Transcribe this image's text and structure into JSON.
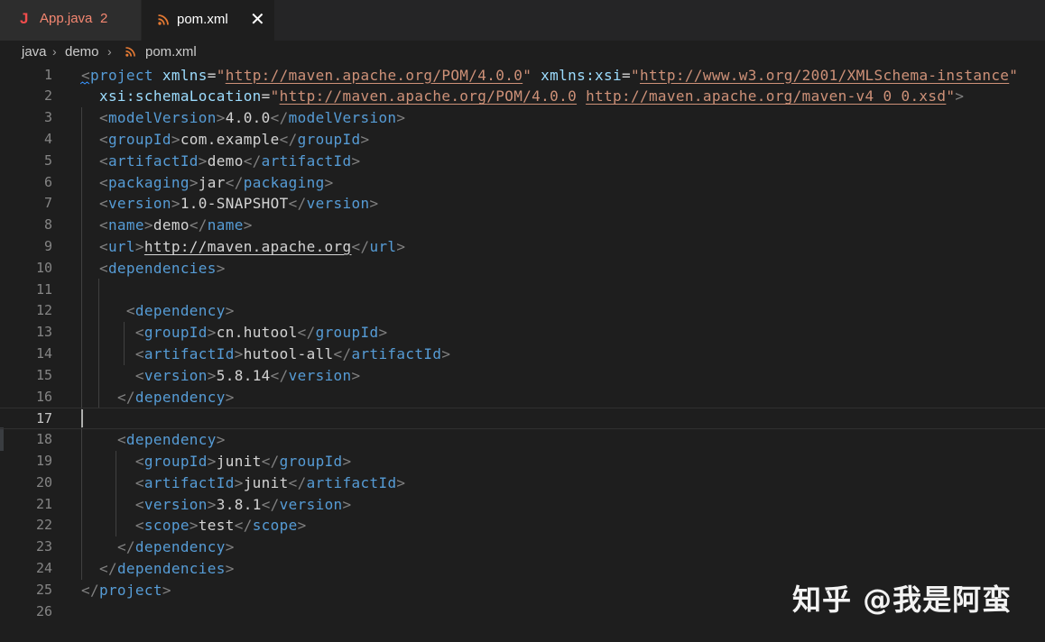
{
  "tabs": [
    {
      "icon": "java-file-icon",
      "label": "App.java",
      "badge": "2",
      "active": false
    },
    {
      "icon": "xml-rss-file-icon",
      "label": "pom.xml",
      "active": true,
      "close": "✕"
    }
  ],
  "breadcrumb": {
    "items": [
      "java",
      "demo",
      "pom.xml"
    ],
    "separator": "›"
  },
  "editor": {
    "current_line": 17,
    "line_numbers": [
      "1",
      "2",
      "3",
      "4",
      "5",
      "6",
      "7",
      "8",
      "9",
      "10",
      "11",
      "12",
      "13",
      "14",
      "15",
      "16",
      "17",
      "18",
      "19",
      "20",
      "21",
      "22",
      "23",
      "24",
      "25",
      "26"
    ],
    "lines": [
      [
        [
          "tag",
          "<"
        ],
        [
          "name",
          "project"
        ],
        [
          "text",
          " "
        ],
        [
          "attr",
          "xmlns"
        ],
        [
          "eq",
          "="
        ],
        [
          "str",
          "\""
        ],
        [
          "url",
          "http://maven.apache.org/POM/4.0.0"
        ],
        [
          "str",
          "\""
        ],
        [
          "text",
          " "
        ],
        [
          "attr",
          "xmlns:xsi"
        ],
        [
          "eq",
          "="
        ],
        [
          "str",
          "\""
        ],
        [
          "url",
          "http://www.w3.org/2001/XMLSchema-instance"
        ],
        [
          "str",
          "\""
        ]
      ],
      [
        [
          "text",
          "  "
        ],
        [
          "attr",
          "xsi:schemaLocation"
        ],
        [
          "eq",
          "="
        ],
        [
          "str",
          "\""
        ],
        [
          "url",
          "http://maven.apache.org/POM/4.0.0"
        ],
        [
          "str",
          " "
        ],
        [
          "url",
          "http://maven.apache.org/maven-v4_0_0.xsd"
        ],
        [
          "str",
          "\""
        ],
        [
          "tag",
          ">"
        ]
      ],
      [
        [
          "text",
          "  "
        ],
        [
          "tag",
          "<"
        ],
        [
          "name",
          "modelVersion"
        ],
        [
          "tag",
          ">"
        ],
        [
          "text",
          "4.0.0"
        ],
        [
          "tag",
          "</"
        ],
        [
          "name",
          "modelVersion"
        ],
        [
          "tag",
          ">"
        ]
      ],
      [
        [
          "text",
          "  "
        ],
        [
          "tag",
          "<"
        ],
        [
          "name",
          "groupId"
        ],
        [
          "tag",
          ">"
        ],
        [
          "text",
          "com.example"
        ],
        [
          "tag",
          "</"
        ],
        [
          "name",
          "groupId"
        ],
        [
          "tag",
          ">"
        ]
      ],
      [
        [
          "text",
          "  "
        ],
        [
          "tag",
          "<"
        ],
        [
          "name",
          "artifactId"
        ],
        [
          "tag",
          ">"
        ],
        [
          "text",
          "demo"
        ],
        [
          "tag",
          "</"
        ],
        [
          "name",
          "artifactId"
        ],
        [
          "tag",
          ">"
        ]
      ],
      [
        [
          "text",
          "  "
        ],
        [
          "tag",
          "<"
        ],
        [
          "name",
          "packaging"
        ],
        [
          "tag",
          ">"
        ],
        [
          "text",
          "jar"
        ],
        [
          "tag",
          "</"
        ],
        [
          "name",
          "packaging"
        ],
        [
          "tag",
          ">"
        ]
      ],
      [
        [
          "text",
          "  "
        ],
        [
          "tag",
          "<"
        ],
        [
          "name",
          "version"
        ],
        [
          "tag",
          ">"
        ],
        [
          "text",
          "1.0-SNAPSHOT"
        ],
        [
          "tag",
          "</"
        ],
        [
          "name",
          "version"
        ],
        [
          "tag",
          ">"
        ]
      ],
      [
        [
          "text",
          "  "
        ],
        [
          "tag",
          "<"
        ],
        [
          "name",
          "name"
        ],
        [
          "tag",
          ">"
        ],
        [
          "text",
          "demo"
        ],
        [
          "tag",
          "</"
        ],
        [
          "name",
          "name"
        ],
        [
          "tag",
          ">"
        ]
      ],
      [
        [
          "text",
          "  "
        ],
        [
          "tag",
          "<"
        ],
        [
          "name",
          "url"
        ],
        [
          "tag",
          ">"
        ],
        [
          "texturl",
          "http://maven.apache.org"
        ],
        [
          "tag",
          "</"
        ],
        [
          "name",
          "url"
        ],
        [
          "tag",
          ">"
        ]
      ],
      [
        [
          "text",
          "  "
        ],
        [
          "tag",
          "<"
        ],
        [
          "name",
          "dependencies"
        ],
        [
          "tag",
          ">"
        ]
      ],
      [],
      [
        [
          "text",
          "     "
        ],
        [
          "tag",
          "<"
        ],
        [
          "name",
          "dependency"
        ],
        [
          "tag",
          ">"
        ]
      ],
      [
        [
          "text",
          "      "
        ],
        [
          "tag",
          "<"
        ],
        [
          "name",
          "groupId"
        ],
        [
          "tag",
          ">"
        ],
        [
          "text",
          "cn.hutool"
        ],
        [
          "tag",
          "</"
        ],
        [
          "name",
          "groupId"
        ],
        [
          "tag",
          ">"
        ]
      ],
      [
        [
          "text",
          "      "
        ],
        [
          "tag",
          "<"
        ],
        [
          "name",
          "artifactId"
        ],
        [
          "tag",
          ">"
        ],
        [
          "text",
          "hutool-all"
        ],
        [
          "tag",
          "</"
        ],
        [
          "name",
          "artifactId"
        ],
        [
          "tag",
          ">"
        ]
      ],
      [
        [
          "text",
          "      "
        ],
        [
          "tag",
          "<"
        ],
        [
          "name",
          "version"
        ],
        [
          "tag",
          ">"
        ],
        [
          "text",
          "5.8.14"
        ],
        [
          "tag",
          "</"
        ],
        [
          "name",
          "version"
        ],
        [
          "tag",
          ">"
        ]
      ],
      [
        [
          "text",
          "    "
        ],
        [
          "tag",
          "</"
        ],
        [
          "name",
          "dependency"
        ],
        [
          "tag",
          ">"
        ]
      ],
      [],
      [
        [
          "text",
          "    "
        ],
        [
          "tag",
          "<"
        ],
        [
          "name",
          "dependency"
        ],
        [
          "tag",
          ">"
        ]
      ],
      [
        [
          "text",
          "      "
        ],
        [
          "tag",
          "<"
        ],
        [
          "name",
          "groupId"
        ],
        [
          "tag",
          ">"
        ],
        [
          "text",
          "junit"
        ],
        [
          "tag",
          "</"
        ],
        [
          "name",
          "groupId"
        ],
        [
          "tag",
          ">"
        ]
      ],
      [
        [
          "text",
          "      "
        ],
        [
          "tag",
          "<"
        ],
        [
          "name",
          "artifactId"
        ],
        [
          "tag",
          ">"
        ],
        [
          "text",
          "junit"
        ],
        [
          "tag",
          "</"
        ],
        [
          "name",
          "artifactId"
        ],
        [
          "tag",
          ">"
        ]
      ],
      [
        [
          "text",
          "      "
        ],
        [
          "tag",
          "<"
        ],
        [
          "name",
          "version"
        ],
        [
          "tag",
          ">"
        ],
        [
          "text",
          "3.8.1"
        ],
        [
          "tag",
          "</"
        ],
        [
          "name",
          "version"
        ],
        [
          "tag",
          ">"
        ]
      ],
      [
        [
          "text",
          "      "
        ],
        [
          "tag",
          "<"
        ],
        [
          "name",
          "scope"
        ],
        [
          "tag",
          ">"
        ],
        [
          "text",
          "test"
        ],
        [
          "tag",
          "</"
        ],
        [
          "name",
          "scope"
        ],
        [
          "tag",
          ">"
        ]
      ],
      [
        [
          "text",
          "    "
        ],
        [
          "tag",
          "</"
        ],
        [
          "name",
          "dependency"
        ],
        [
          "tag",
          ">"
        ]
      ],
      [
        [
          "text",
          "  "
        ],
        [
          "tag",
          "</"
        ],
        [
          "name",
          "dependencies"
        ],
        [
          "tag",
          ">"
        ]
      ],
      [
        [
          "tag",
          "</"
        ],
        [
          "name",
          "project"
        ],
        [
          "tag",
          ">"
        ]
      ],
      []
    ]
  },
  "watermark": "知乎 @我是阿蛮",
  "colors": {
    "background": "#1e1e1e",
    "tag_bracket": "#808080",
    "tag_name": "#569cd6",
    "attribute": "#9cdcfe",
    "string": "#ce9178",
    "text": "#d4d4d4",
    "line_number": "#858585",
    "java_icon": "#f14c4c",
    "xml_icon": "#e37933"
  }
}
